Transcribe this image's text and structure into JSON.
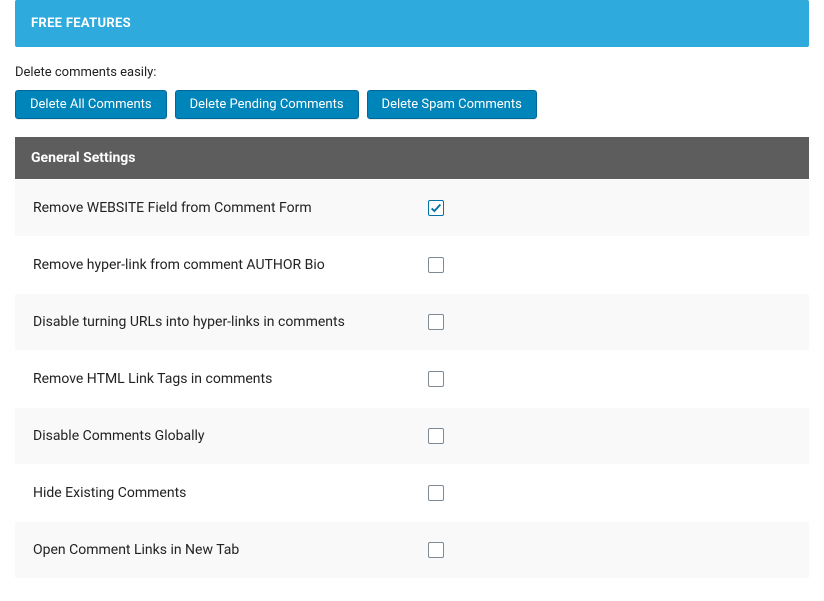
{
  "banner": {
    "title": "FREE FEATURES"
  },
  "intro_text": "Delete comments easily:",
  "buttons": {
    "delete_all": "Delete All Comments",
    "delete_pending": "Delete Pending Comments",
    "delete_spam": "Delete Spam Comments"
  },
  "section": {
    "title": "General Settings"
  },
  "settings": [
    {
      "label": "Remove WEBSITE Field from Comment Form",
      "checked": true
    },
    {
      "label": "Remove hyper-link from comment AUTHOR Bio",
      "checked": false
    },
    {
      "label": "Disable turning URLs into hyper-links in comments",
      "checked": false
    },
    {
      "label": "Remove HTML Link Tags in comments",
      "checked": false
    },
    {
      "label": "Disable Comments Globally",
      "checked": false
    },
    {
      "label": "Hide Existing Comments",
      "checked": false
    },
    {
      "label": "Open Comment Links in New Tab",
      "checked": false
    }
  ]
}
